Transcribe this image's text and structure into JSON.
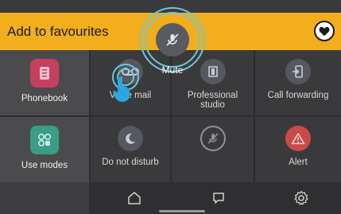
{
  "header": {
    "title": "Add to favourites",
    "favourite_icon": "heart-icon"
  },
  "grid": {
    "phonebook": "Phonebook",
    "voicemail": "Voice mail",
    "professional_studio": "Professional studio",
    "call_forwarding": "Call forwarding",
    "use_modes": "Use modes",
    "do_not_disturb": "Do not disturb",
    "mute_tile": "",
    "alert": "Alert"
  },
  "overlay": {
    "label": "Mute",
    "icon": "mute-icon"
  },
  "nav": {
    "home_icon": "home-icon",
    "messages_icon": "chat-icon",
    "settings_icon": "gear-icon"
  },
  "colors": {
    "accent": "#f2ae1c",
    "highlight": "#6fc7d6",
    "alert": "#c94a4a",
    "phonebook": "#c5405f",
    "use_modes": "#3a9d85"
  },
  "pagination": {
    "active_dot_color": "#f2ae1c"
  }
}
